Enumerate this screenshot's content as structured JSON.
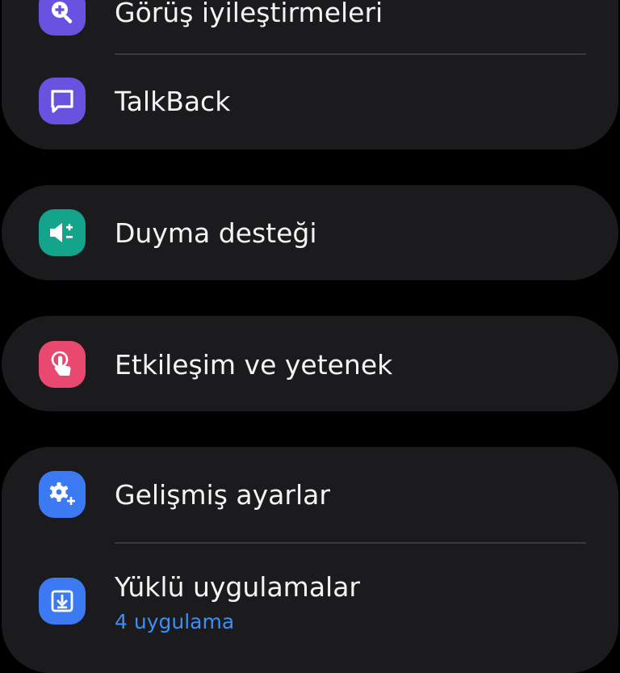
{
  "colors": {
    "background": "#000000",
    "card": "#1b1b1d",
    "text": "#f4f4f4",
    "divider": "#3a3a3c",
    "link": "#3e8ef7"
  },
  "items": [
    {
      "label": "Görüş iyileştirmeleri",
      "icon": "magnifier-plus-icon",
      "color": "#6a52e0"
    },
    {
      "label": "TalkBack",
      "icon": "speech-bubble-icon",
      "color": "#6a52e0"
    },
    {
      "label": "Duyma desteği",
      "icon": "hearing-speaker-icon",
      "color": "#14a48c"
    },
    {
      "label": "Etkileşim ve yetenek",
      "icon": "touch-hand-icon",
      "color": "#e9486f"
    },
    {
      "label": "Gelişmiş ayarlar",
      "icon": "gear-plus-icon",
      "color": "#3b7af3"
    },
    {
      "label": "Yüklü uygulamalar",
      "sublabel": "4 uygulama",
      "icon": "download-icon",
      "color": "#3b7af3"
    }
  ]
}
